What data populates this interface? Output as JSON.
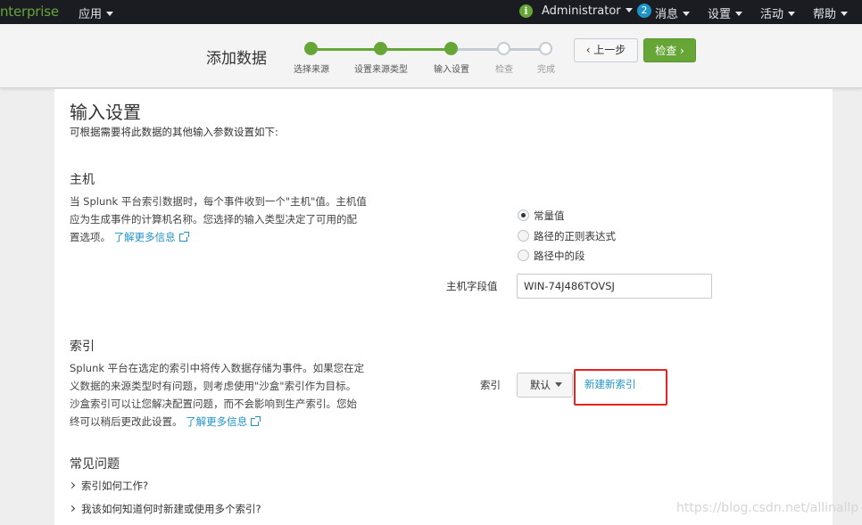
{
  "topbar": {
    "brand": "nterprise",
    "app_menu": "应用",
    "info_icon": "i",
    "user": "Administrator",
    "messages_count": "2",
    "messages": "消息",
    "settings": "设置",
    "activity": "活动",
    "help": "帮助"
  },
  "wizard": {
    "title": "添加数据",
    "steps": [
      {
        "label": "选择来源",
        "state": "done"
      },
      {
        "label": "设置来源类型",
        "state": "done"
      },
      {
        "label": "输入设置",
        "state": "done"
      },
      {
        "label": "检查",
        "state": "todo"
      },
      {
        "label": "完成",
        "state": "todo"
      }
    ],
    "prev_button": "‹ 上一步",
    "next_button": "检查 ›"
  },
  "page": {
    "title": "输入设置",
    "subtitle": "可根据需要将此数据的其他输入参数设置如下:"
  },
  "host": {
    "heading": "主机",
    "desc_lines": [
      "当 Splunk 平台索引数据时，每个事件收到一个\"主机\"值。主机值",
      "应为生成事件的计算机名称。您选择的输入类型决定了可用的配",
      "置选项。"
    ],
    "learn_more": "了解更多信息",
    "options": [
      {
        "label": "常量值",
        "selected": true
      },
      {
        "label": "路径的正则表达式",
        "selected": false
      },
      {
        "label": "路径中的段",
        "selected": false
      }
    ],
    "field_label": "主机字段值",
    "field_value": "WIN-74J486TOVSJ"
  },
  "index": {
    "heading": "索引",
    "desc_lines": [
      "Splunk 平台在选定的索引中将传入数据存储为事件。如果您在定",
      "义数据的来源类型时有问题，则考虑使用\"沙盒\"索引作为目标。",
      "沙盒索引可以让您解决配置问题，而不会影响到生产索引。您始",
      "终可以稍后更改此设置。"
    ],
    "learn_more": "了解更多信息",
    "field_label": "索引",
    "dropdown_value": "默认",
    "new_index_link": "新建新索引"
  },
  "faq": {
    "heading": "常见问题",
    "items": [
      "索引如何工作?",
      "我该如何知道何时新建或使用多个索引?"
    ]
  },
  "watermark": "https://blog.csdn.net/allinallp",
  "colors": {
    "accent_green": "#65a637",
    "link_blue": "#1e93c6",
    "highlight_red": "#e8221e",
    "topbar": "#1a1c21"
  }
}
